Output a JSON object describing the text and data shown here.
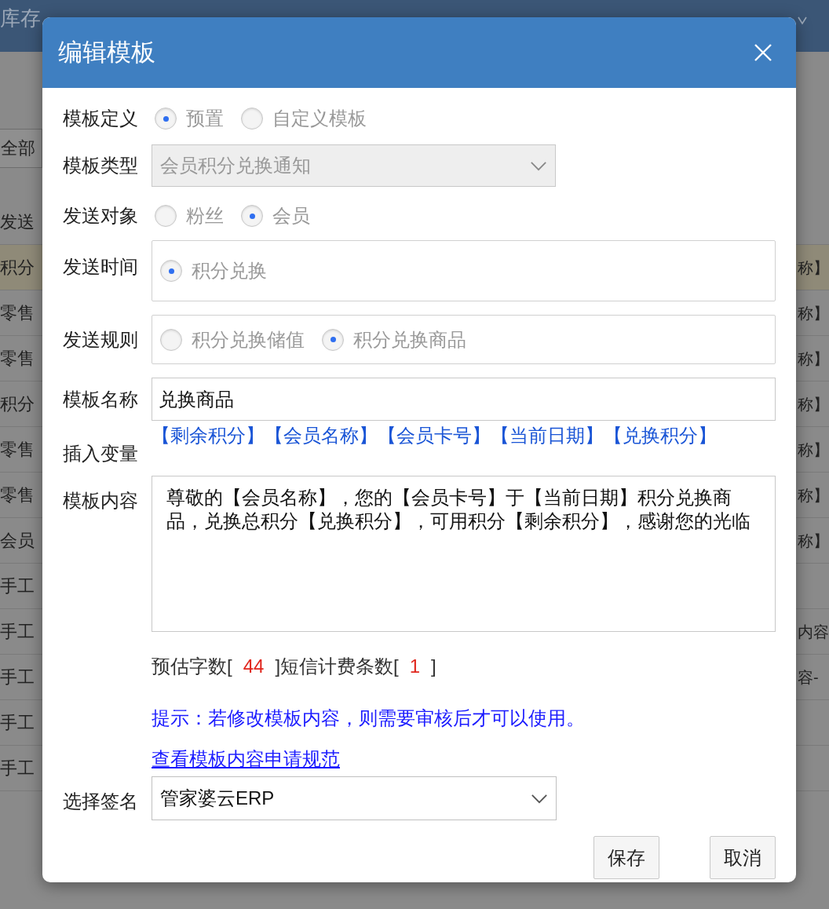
{
  "background": {
    "nav": [
      "库存"
    ],
    "filter": "全部",
    "header": "发送",
    "rows": [
      {
        "col_1": "积分",
        "col_2": "称】",
        "selected": true
      },
      {
        "col_1": "零售",
        "col_2": "称】",
        "selected": false
      },
      {
        "col_1": "零售",
        "col_2": "称】",
        "selected": false
      },
      {
        "col_1": "积分",
        "col_2": "称】",
        "selected": false
      },
      {
        "col_1": "零售",
        "col_2": "称】",
        "selected": false
      },
      {
        "col_1": "零售",
        "col_2": "称】",
        "selected": false
      },
      {
        "col_1": "会员",
        "col_2": "称】",
        "selected": false
      },
      {
        "col_1": "手工",
        "selected": false
      },
      {
        "col_1": "手工",
        "col_2": "内容",
        "selected": false
      },
      {
        "col_1": "手工",
        "col_2": "容-",
        "selected": false
      },
      {
        "col_1": "手工",
        "selected": false
      },
      {
        "col_1": "手工",
        "selected": false
      }
    ]
  },
  "dialog": {
    "title": "编辑模板",
    "fields": [
      {
        "kind": "radio",
        "label": "模板定义",
        "disabled": true,
        "options": [
          {
            "label": "预置",
            "selected": true
          },
          {
            "label": "自定义模板",
            "selected": false
          }
        ]
      },
      {
        "kind": "select",
        "label": "模板类型",
        "disabled": true,
        "value": "会员积分兑换通知"
      },
      {
        "kind": "radio",
        "label": "发送对象",
        "disabled": true,
        "options": [
          {
            "label": "粉丝",
            "selected": false
          },
          {
            "label": "会员",
            "selected": true
          }
        ]
      },
      {
        "kind": "radio_box",
        "label": "发送时间",
        "disabled": true,
        "options": [
          {
            "label": "积分兑换",
            "selected": true
          }
        ]
      },
      {
        "kind": "radio_box",
        "label": "发送规则",
        "disabled": true,
        "options": [
          {
            "label": "积分兑换储值",
            "selected": false
          },
          {
            "label": "积分兑换商品",
            "selected": true
          }
        ]
      },
      {
        "kind": "input",
        "label": "模板名称",
        "value": "兑换商品"
      },
      {
        "kind": "variables",
        "label": "插入变量",
        "items": [
          "【剩余积分】",
          "【会员名称】",
          "【会员卡号】",
          "【当前日期】",
          "【兑换积分】"
        ]
      },
      {
        "kind": "textarea",
        "label": "模板内容",
        "value": "尊敬的【会员名称】，您的【会员卡号】于【当前日期】积分兑换商品，兑换总积分【兑换积分】，可用积分【剩余积分】，感谢您的光临"
      }
    ],
    "count": {
      "chars_label": "预估字数[",
      "chars": "44",
      "sms_label": "]短信计费条数[",
      "sms": "1",
      "close": "]"
    },
    "hint": "提示：若修改模板内容，则需要审核后才可以使用。",
    "rules_link": "查看模板内容申请规范",
    "signature": {
      "label": "选择签名",
      "value": "管家婆云ERP"
    },
    "buttons": [
      "保存",
      "取消"
    ]
  }
}
